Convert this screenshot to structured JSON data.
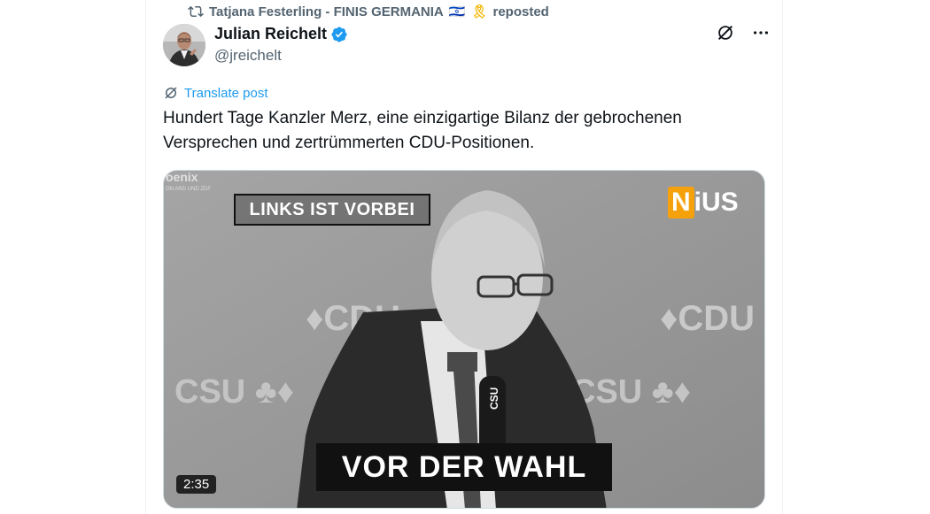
{
  "repost": {
    "user": "Tatjana Festerling - FINIS GERMANIA",
    "flag": "🇮🇱",
    "ribbon": "🎗",
    "label": "reposted"
  },
  "author": {
    "name": "Julian Reichelt",
    "handle": "@jreichelt"
  },
  "translate_label": "Translate post",
  "post_text": "Hundert Tage Kanzler Merz, eine einzigartige Bilanz der gebrochenen Versprechen und zertrümmerten CDU-Positionen.",
  "video": {
    "channel_logo": "oenix",
    "channel_sub": "ON ARD UND ZDF",
    "caption_top": "LINKS IST VORBEI",
    "brand_n": "N",
    "brand_rest": "iUS",
    "caption_bottom": "VOR DER WAHL",
    "duration": "2:35",
    "backdrop_cdu": "CDU",
    "backdrop_csu": "CSU",
    "mic_label": "CSU"
  },
  "colors": {
    "accent": "#1d9bf0",
    "muted": "#536471",
    "brand_orange": "#f5a10b"
  },
  "icons": {
    "repost": "repost-icon",
    "verified": "verified-badge-icon",
    "grok": "grok-icon",
    "more": "more-icon",
    "translate": "translate-icon"
  }
}
